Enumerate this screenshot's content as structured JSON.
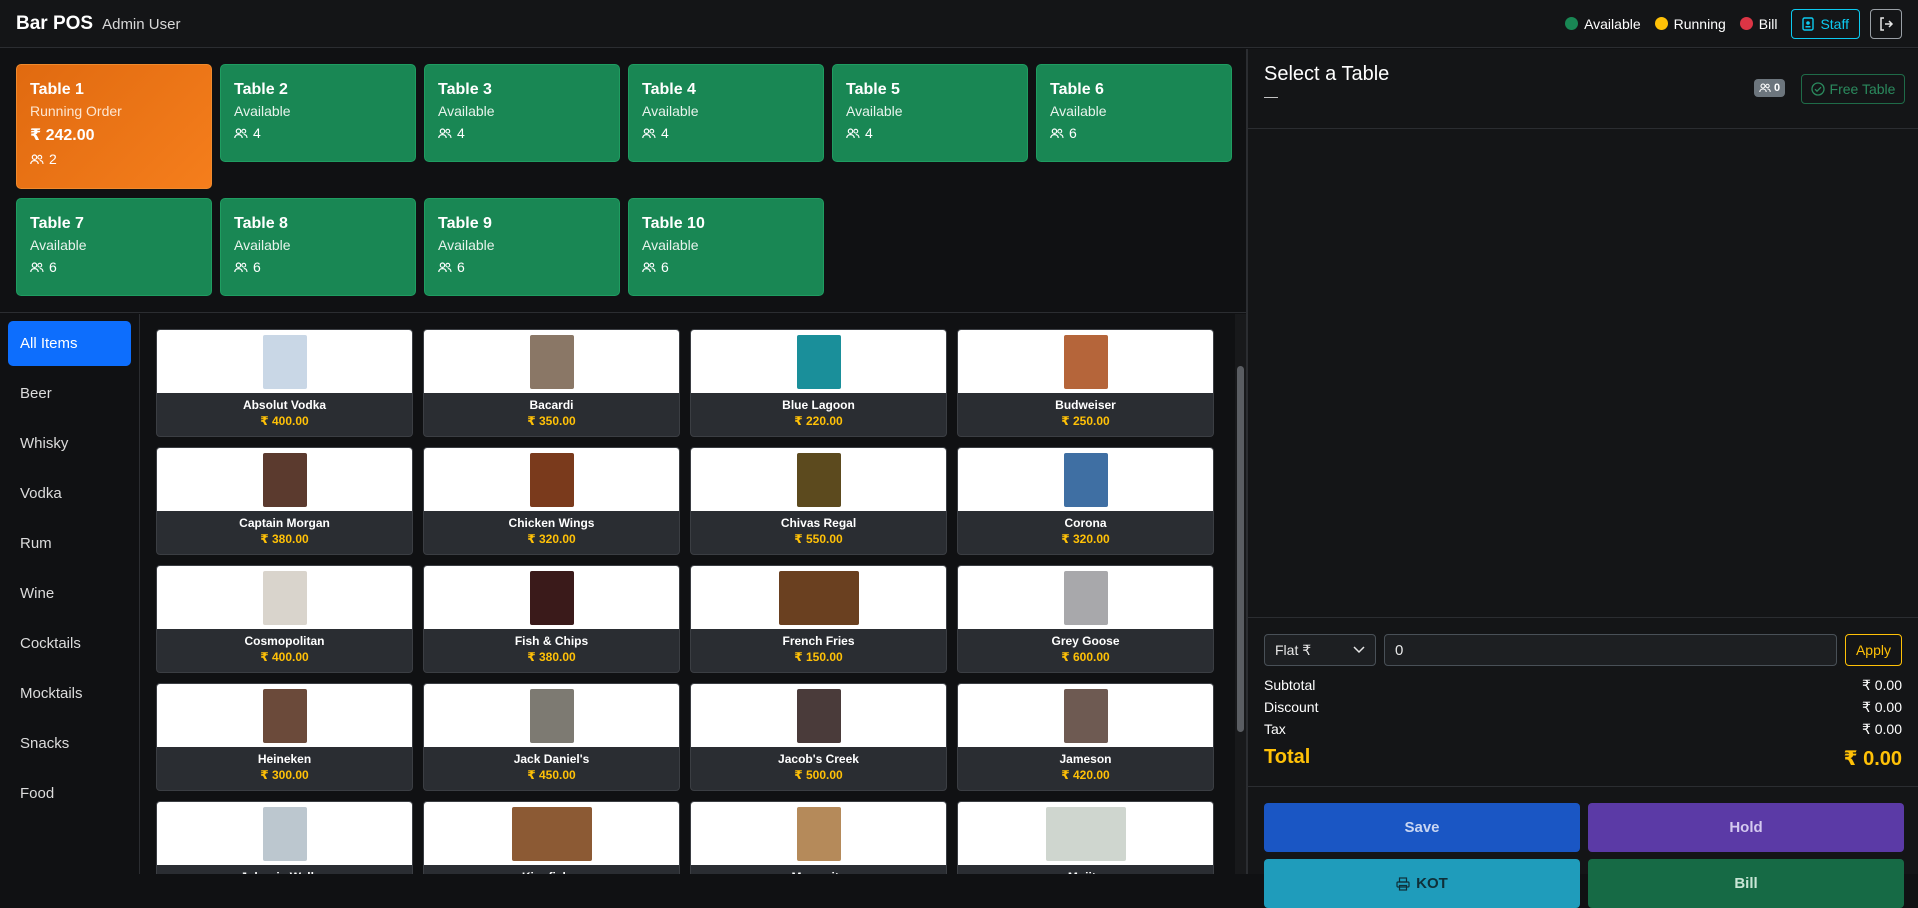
{
  "header": {
    "brand": "Bar POS",
    "user": "Admin User",
    "legend": [
      {
        "label": "Available",
        "color": "#198754"
      },
      {
        "label": "Running",
        "color": "#ffc107"
      },
      {
        "label": "Bill",
        "color": "#dc3545"
      }
    ],
    "staff_label": "Staff"
  },
  "tables": [
    {
      "name": "Table 1",
      "status": "Running Order",
      "amount": "₹ 242.00",
      "seats": "2",
      "state": "running"
    },
    {
      "name": "Table 2",
      "status": "Available",
      "seats": "4",
      "state": "available"
    },
    {
      "name": "Table 3",
      "status": "Available",
      "seats": "4",
      "state": "available"
    },
    {
      "name": "Table 4",
      "status": "Available",
      "seats": "4",
      "state": "available"
    },
    {
      "name": "Table 5",
      "status": "Available",
      "seats": "4",
      "state": "available"
    },
    {
      "name": "Table 6",
      "status": "Available",
      "seats": "6",
      "state": "available"
    },
    {
      "name": "Table 7",
      "status": "Available",
      "seats": "6",
      "state": "available"
    },
    {
      "name": "Table 8",
      "status": "Available",
      "seats": "6",
      "state": "available"
    },
    {
      "name": "Table 9",
      "status": "Available",
      "seats": "6",
      "state": "available"
    },
    {
      "name": "Table 10",
      "status": "Available",
      "seats": "6",
      "state": "available"
    }
  ],
  "categories": [
    "All Items",
    "Beer",
    "Whisky",
    "Vodka",
    "Rum",
    "Wine",
    "Cocktails",
    "Mocktails",
    "Snacks",
    "Food"
  ],
  "active_category": "All Items",
  "items": [
    {
      "name": "Absolut Vodka",
      "price": "₹ 400.00",
      "color": "#c9d7e6"
    },
    {
      "name": "Bacardi",
      "price": "₹ 350.00",
      "color": "#8a7766"
    },
    {
      "name": "Blue Lagoon",
      "price": "₹ 220.00",
      "color": "#1a8f9a"
    },
    {
      "name": "Budweiser",
      "price": "₹ 250.00",
      "color": "#b5653a"
    },
    {
      "name": "Captain Morgan",
      "price": "₹ 380.00",
      "color": "#5b3a2e"
    },
    {
      "name": "Chicken Wings",
      "price": "₹ 320.00",
      "color": "#7a3a1c"
    },
    {
      "name": "Chivas Regal",
      "price": "₹ 550.00",
      "color": "#5c4a1e"
    },
    {
      "name": "Corona",
      "price": "₹ 320.00",
      "color": "#3f6fa3"
    },
    {
      "name": "Cosmopolitan",
      "price": "₹ 400.00",
      "color": "#d9d4cc"
    },
    {
      "name": "Fish & Chips",
      "price": "₹ 380.00",
      "color": "#3a1a1a"
    },
    {
      "name": "French Fries",
      "price": "₹ 150.00",
      "color": "#6a4020"
    },
    {
      "name": "Grey Goose",
      "price": "₹ 600.00",
      "color": "#a8a8ab"
    },
    {
      "name": "Heineken",
      "price": "₹ 300.00",
      "color": "#6b4a3a"
    },
    {
      "name": "Jack Daniel's",
      "price": "₹ 450.00",
      "color": "#7d7a72"
    },
    {
      "name": "Jacob's Creek",
      "price": "₹ 500.00",
      "color": "#4a3b3a"
    },
    {
      "name": "Jameson",
      "price": "₹ 420.00",
      "color": "#6e5a52"
    },
    {
      "name": "Johnnie Walker",
      "price": "",
      "color": "#bcc7cf"
    },
    {
      "name": "Kingfisher",
      "price": "",
      "color": "#8c5a34"
    },
    {
      "name": "Margarita",
      "price": "",
      "color": "#b58a5a"
    },
    {
      "name": "Mojito",
      "price": "",
      "color": "#cfd6cf"
    }
  ],
  "order": {
    "title": "Select a Table",
    "subtitle": "—",
    "guest_count": "0",
    "free_table_label": "Free Table",
    "discount_type": "Flat ₹",
    "discount_value": "0",
    "apply_label": "Apply",
    "subtotal_label": "Subtotal",
    "subtotal": "₹ 0.00",
    "discount_label": "Discount",
    "discount": "₹ 0.00",
    "tax_label": "Tax",
    "tax": "₹ 0.00",
    "total_label": "Total",
    "total": "₹ 0.00"
  },
  "actions": {
    "save": "Save",
    "hold": "Hold",
    "kot": "KOT",
    "bill": "Bill",
    "colors": {
      "save": "#1a56c4",
      "hold": "#5b3aa6",
      "kot": "#1f9cbb",
      "bill": "#166a45"
    }
  }
}
